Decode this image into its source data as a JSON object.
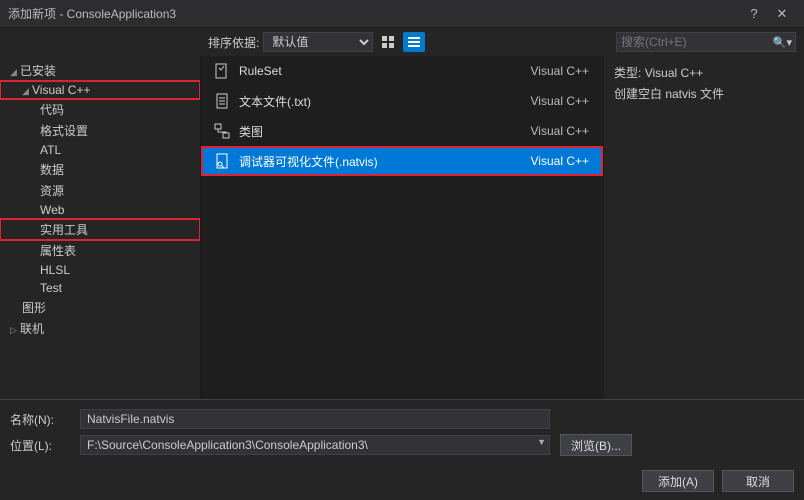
{
  "titlebar": {
    "title": "添加新项 - ConsoleApplication3",
    "help": "?",
    "close": "✕"
  },
  "toolbar": {
    "sort_label": "排序依据:",
    "sort_value": "默认值",
    "search_placeholder": "搜索(Ctrl+E)"
  },
  "sidebar": {
    "installed": "已安装",
    "visual_cpp": "Visual C++",
    "items": [
      "代码",
      "格式设置",
      "ATL",
      "数据",
      "资源",
      "Web",
      "实用工具",
      "属性表",
      "HLSL",
      "Test"
    ],
    "graphics": "图形",
    "online": "联机"
  },
  "templates": [
    {
      "label": "RuleSet",
      "lang": "Visual C++"
    },
    {
      "label": "文本文件(.txt)",
      "lang": "Visual C++"
    },
    {
      "label": "类图",
      "lang": "Visual C++"
    },
    {
      "label": "调试器可视化文件(.natvis)",
      "lang": "Visual C++"
    }
  ],
  "detail": {
    "type_label": "类型:",
    "type_value": "Visual C++",
    "desc": "创建空白 natvis 文件"
  },
  "form": {
    "name_label": "名称(N):",
    "name_value": "NatvisFile.natvis",
    "loc_label": "位置(L):",
    "loc_value": "F:\\Source\\ConsoleApplication3\\ConsoleApplication3\\",
    "browse": "浏览(B)..."
  },
  "footer": {
    "add": "添加(A)",
    "cancel": "取消"
  }
}
